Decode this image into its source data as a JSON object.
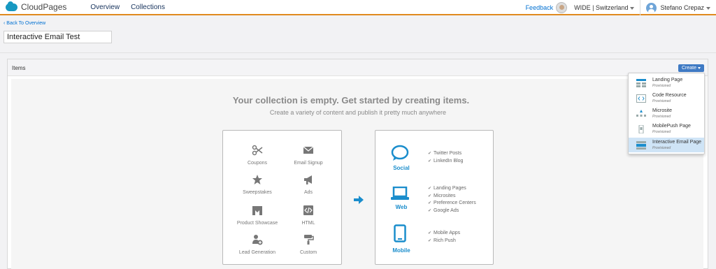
{
  "topnav": {
    "app_name": "CloudPages",
    "links": [
      "Overview",
      "Collections"
    ],
    "feedback": "Feedback",
    "business_unit": "WIDE | Switzerland",
    "user_name": "Stefano Crepaz"
  },
  "page": {
    "back_link": "‹ Back To Overview",
    "collection_name": "Interactive Email Test"
  },
  "items_panel": {
    "title": "Items",
    "create_button": "Create"
  },
  "empty_state": {
    "title": "Your collection is empty. Get started by creating items.",
    "subtitle": "Create a variety of content and publish it pretty much anywhere"
  },
  "content_types": [
    {
      "label": "Coupons",
      "icon": "scissors-icon"
    },
    {
      "label": "Email Signup",
      "icon": "envelope-icon"
    },
    {
      "label": "Sweepstakes",
      "icon": "star-icon"
    },
    {
      "label": "Ads",
      "icon": "megaphone-icon"
    },
    {
      "label": "Product Showcase",
      "icon": "storefront-icon"
    },
    {
      "label": "HTML",
      "icon": "code-icon"
    },
    {
      "label": "Lead Generation",
      "icon": "add-user-icon"
    },
    {
      "label": "Custom",
      "icon": "paint-roller-icon"
    }
  ],
  "channels": [
    {
      "name": "Social",
      "icon": "speech-bubble-icon",
      "items": [
        "Twitter Posts",
        "LinkedIn Blog"
      ]
    },
    {
      "name": "Web",
      "icon": "laptop-icon",
      "items": [
        "Landing Pages",
        "Microsites",
        "Preference Centers",
        "Google Ads"
      ]
    },
    {
      "name": "Mobile",
      "icon": "tablet-icon",
      "items": [
        "Mobile Apps",
        "Rich Push"
      ]
    }
  ],
  "create_menu": [
    {
      "name": "Landing Page",
      "status": "Provisioned",
      "icon": "landing-page-icon"
    },
    {
      "name": "Code Resource",
      "status": "Provisioned",
      "icon": "code-resource-icon"
    },
    {
      "name": "Microsite",
      "status": "Provisioned",
      "icon": "microsite-icon"
    },
    {
      "name": "MobilePush Page",
      "status": "Provisioned",
      "icon": "mobilepush-icon"
    },
    {
      "name": "Interactive Email Page",
      "status": "Provisioned",
      "icon": "interactive-email-icon",
      "highlighted": true
    }
  ],
  "colors": {
    "accent_orange": "#e08a1e",
    "brand_blue": "#1a8dcc",
    "create_button": "#3f7ac4",
    "menu_highlight": "#cfe4f6"
  }
}
